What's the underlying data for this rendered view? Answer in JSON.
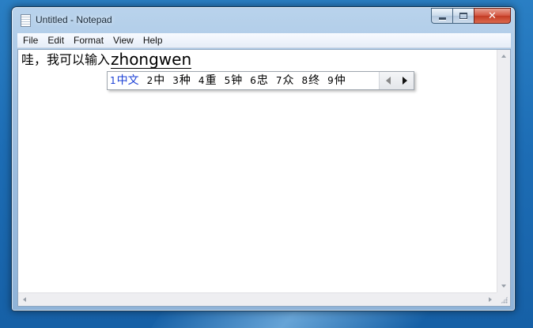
{
  "window": {
    "title": "Untitled - Notepad",
    "caption_buttons": {
      "minimize": "",
      "maximize": "",
      "close": "✕"
    }
  },
  "menu": {
    "items": [
      {
        "id": "file",
        "label": "File"
      },
      {
        "id": "edit",
        "label": "Edit"
      },
      {
        "id": "format",
        "label": "Format"
      },
      {
        "id": "view",
        "label": "View"
      },
      {
        "id": "help",
        "label": "Help"
      }
    ]
  },
  "editor": {
    "typed_text": "哇，我可以输入",
    "composition_text": "zhongwen"
  },
  "ime": {
    "selected_index": 0,
    "candidates": [
      {
        "num": "1",
        "text": "中文"
      },
      {
        "num": "2",
        "text": "中"
      },
      {
        "num": "3",
        "text": "种"
      },
      {
        "num": "4",
        "text": "重"
      },
      {
        "num": "5",
        "text": "钟"
      },
      {
        "num": "6",
        "text": "忠"
      },
      {
        "num": "7",
        "text": "众"
      },
      {
        "num": "8",
        "text": "终"
      },
      {
        "num": "9",
        "text": "仲"
      }
    ]
  },
  "colors": {
    "selected_candidate": "#1a3fd6",
    "close_button": "#c23b24",
    "desktop": "#1d6db5"
  },
  "icons": {
    "app": "notepad-icon",
    "prev": "triangle-left-icon",
    "next": "triangle-right-icon"
  }
}
